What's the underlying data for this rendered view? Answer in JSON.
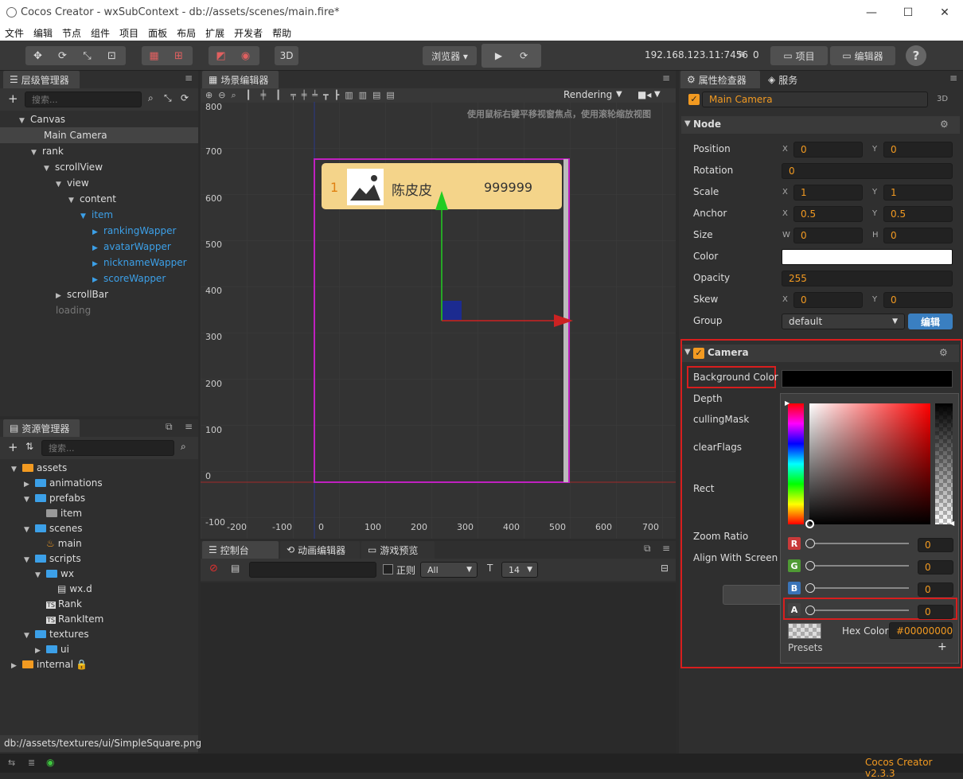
{
  "window": {
    "title": "Cocos Creator - wxSubContext - db://assets/scenes/main.fire*"
  },
  "menu": [
    "文件",
    "编辑",
    "节点",
    "组件",
    "项目",
    "面板",
    "布局",
    "扩展",
    "开发者",
    "帮助"
  ],
  "toolbar": {
    "browser_label": "浏览器 ▾",
    "mode_3d": "3D",
    "ip": "192.168.123.11:7456",
    "client_count": "0",
    "project_label": "项目",
    "editor_label": "编辑器",
    "help": "?"
  },
  "hierarchy": {
    "tab": "层级管理器",
    "search_placeholder": "搜索...",
    "nodes": [
      {
        "label": "Canvas"
      },
      {
        "label": "Main Camera"
      },
      {
        "label": "rank"
      },
      {
        "label": "scrollView"
      },
      {
        "label": "view"
      },
      {
        "label": "content"
      },
      {
        "label": "item"
      },
      {
        "label": "rankingWapper"
      },
      {
        "label": "avatarWapper"
      },
      {
        "label": "nicknameWapper"
      },
      {
        "label": "scoreWapper"
      },
      {
        "label": "scrollBar"
      },
      {
        "label": "loading"
      }
    ]
  },
  "assets": {
    "tab": "资源管理器",
    "search_placeholder": "搜索...",
    "items": [
      {
        "label": "assets"
      },
      {
        "label": "animations"
      },
      {
        "label": "prefabs"
      },
      {
        "label": "item"
      },
      {
        "label": "scenes"
      },
      {
        "label": "main"
      },
      {
        "label": "scripts"
      },
      {
        "label": "wx"
      },
      {
        "label": "wx.d"
      },
      {
        "label": "Rank"
      },
      {
        "label": "RankItem"
      },
      {
        "label": "textures"
      },
      {
        "label": "ui"
      },
      {
        "label": "internal"
      }
    ],
    "path": "db://assets/textures/ui/SimpleSquare.png"
  },
  "scene": {
    "tab": "场景编辑器",
    "rendering": "Rendering",
    "hint": "使用鼠标右键平移视窗焦点，使用滚轮缩放视图",
    "y_ticks": [
      "800",
      "700",
      "600",
      "500",
      "400",
      "300",
      "200",
      "100",
      "0",
      "-100"
    ],
    "x_ticks": [
      "-200",
      "-100",
      "0",
      "100",
      "200",
      "300",
      "400",
      "500",
      "600",
      "700"
    ],
    "card": {
      "rank": "1",
      "name": "陈皮皮",
      "score": "999999"
    }
  },
  "console": {
    "tabs": [
      "控制台",
      "动画编辑器",
      "游戏预览"
    ],
    "regex_label": "正则",
    "filter": "All",
    "font_size": "14"
  },
  "inspector": {
    "tabs": [
      "属性检查器",
      "服务"
    ],
    "node_name": "Main Camera",
    "badge_3d": "3D",
    "node_section": "Node",
    "props": {
      "position": {
        "label": "Position",
        "x": "0",
        "y": "0"
      },
      "rotation": {
        "label": "Rotation",
        "value": "0"
      },
      "scale": {
        "label": "Scale",
        "x": "1",
        "y": "1"
      },
      "anchor": {
        "label": "Anchor",
        "x": "0.5",
        "y": "0.5"
      },
      "size": {
        "label": "Size",
        "w": "0",
        "h": "0"
      },
      "color": {
        "label": "Color"
      },
      "opacity": {
        "label": "Opacity",
        "value": "255"
      },
      "skew": {
        "label": "Skew",
        "x": "0",
        "y": "0"
      },
      "group": {
        "label": "Group",
        "value": "default",
        "edit": "编辑"
      }
    },
    "camera_section": "Camera",
    "camera_props": [
      "Background Color",
      "Depth",
      "cullingMask",
      "clearFlags",
      "Rect",
      "Zoom Ratio",
      "Align With Screen"
    ],
    "picker": {
      "r": "0",
      "g": "0",
      "b": "0",
      "a": "0",
      "hex_label": "Hex Color",
      "hex": "#00000000",
      "presets": "Presets"
    }
  },
  "status": {
    "version": "Cocos Creator v2.3.3"
  },
  "colors": {
    "accent": "#f29a21",
    "highlight_red": "#d81e1e",
    "link_blue": "#3ca0e8",
    "frame_purple": "#c020c0"
  }
}
